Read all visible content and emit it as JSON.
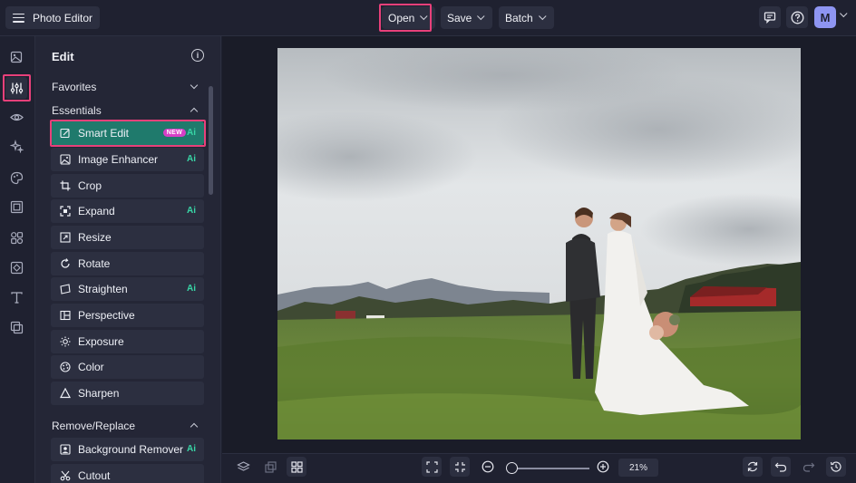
{
  "topbar": {
    "app_title": "Photo Editor",
    "open_label": "Open",
    "save_label": "Save",
    "batch_label": "Batch",
    "avatar_letter": "M"
  },
  "rail": {
    "icons": [
      "image-icon",
      "adjustments-icon",
      "eye-icon",
      "effects-sparkle-icon",
      "palette-icon",
      "frame-icon",
      "graphics-icon",
      "texture-icon",
      "text-icon",
      "collage-icon"
    ]
  },
  "panel": {
    "title": "Edit",
    "sections": {
      "favorites": "Favorites",
      "essentials": "Essentials",
      "remove_replace": "Remove/Replace"
    },
    "tools": [
      {
        "label": "Smart Edit",
        "badge": "NEW",
        "ai": "Ai"
      },
      {
        "label": "Image Enhancer",
        "ai": "Ai"
      },
      {
        "label": "Crop"
      },
      {
        "label": "Expand",
        "ai": "Ai"
      },
      {
        "label": "Resize"
      },
      {
        "label": "Rotate"
      },
      {
        "label": "Straighten",
        "ai": "Ai"
      },
      {
        "label": "Perspective"
      },
      {
        "label": "Exposure"
      },
      {
        "label": "Color"
      },
      {
        "label": "Sharpen"
      }
    ],
    "remove_tools": [
      {
        "label": "Background Remover",
        "ai": "Ai"
      },
      {
        "label": "Cutout"
      }
    ]
  },
  "bottombar": {
    "zoom_value": "21%",
    "zoom_level": 0.05
  },
  "colors": {
    "accent_highlight": "#e8407a",
    "active_tool": "#1f7a6c",
    "ai_label": "#38d6a6",
    "new_badge": "#d63fc6",
    "avatar": "#8e95f2"
  }
}
